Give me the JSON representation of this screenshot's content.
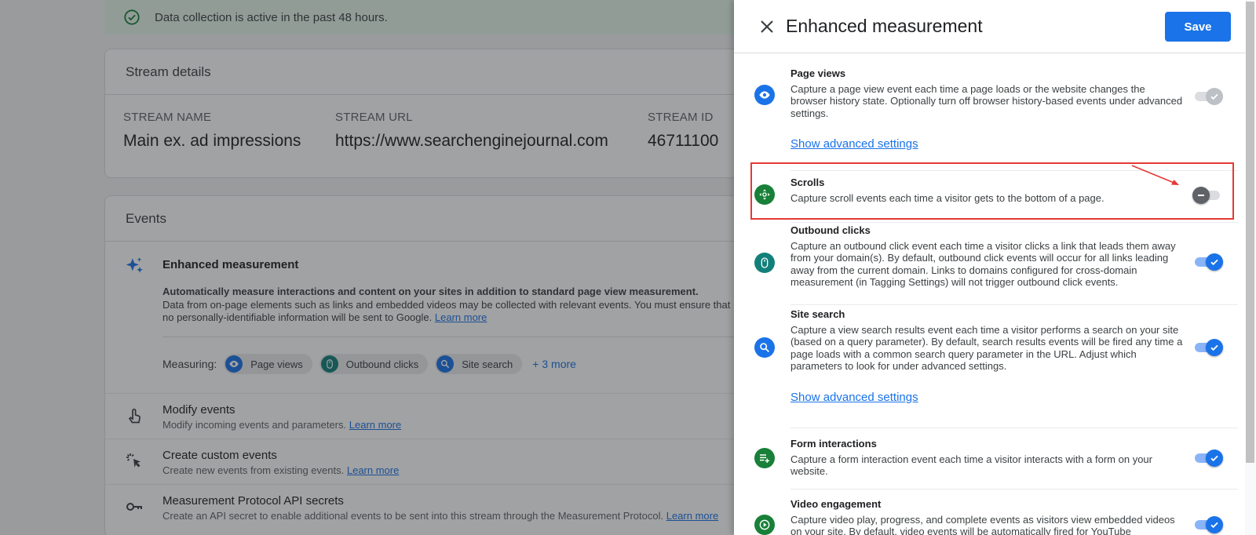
{
  "banner": {
    "text": "Data collection is active in the past 48 hours."
  },
  "stream_details": {
    "title": "Stream details",
    "name_label": "STREAM NAME",
    "name_value": "Main ex. ad impressions",
    "url_label": "STREAM URL",
    "url_value": "https://www.searchenginejournal.com",
    "id_label": "STREAM ID",
    "id_value": "46711100"
  },
  "events": {
    "title": "Events",
    "enhanced": {
      "title": "Enhanced measurement",
      "desc_bold": "Automatically measure interactions and content on your sites in addition to standard page view measurement.",
      "desc_rest": "Data from on-page elements such as links and embedded videos may be collected with relevant events. You must ensure that no personally-identifiable information will be sent to Google.",
      "learn_more": "Learn more",
      "measuring_label": "Measuring:",
      "chips": [
        "Page views",
        "Outbound clicks",
        "Site search"
      ],
      "more": "+ 3 more"
    },
    "rows": [
      {
        "title": "Modify events",
        "desc": "Modify incoming events and parameters.",
        "link": "Learn more"
      },
      {
        "title": "Create custom events",
        "desc": "Create new events from existing events.",
        "link": "Learn more"
      },
      {
        "title": "Measurement Protocol API secrets",
        "desc": "Create an API secret to enable additional events to be sent into this stream through the Measurement Protocol.",
        "link": "Learn more"
      }
    ]
  },
  "panel": {
    "title": "Enhanced measurement",
    "save_label": "Save",
    "sections": [
      {
        "title": "Page views",
        "desc": "Capture a page view event each time a page loads or the website changes the browser history state. Optionally turn off browser history-based events under advanced settings.",
        "advanced": "Show advanced settings",
        "state": "disabled-on"
      },
      {
        "title": "Scrolls",
        "desc": "Capture scroll events each time a visitor gets to the bottom of a page.",
        "state": "off"
      },
      {
        "title": "Outbound clicks",
        "desc": "Capture an outbound click event each time a visitor clicks a link that leads them away from your domain(s). By default, outbound click events will occur for all links leading away from the current domain. Links to domains configured for cross-domain measurement (in Tagging Settings) will not trigger outbound click events.",
        "state": "on"
      },
      {
        "title": "Site search",
        "desc": "Capture a view search results event each time a visitor performs a search on your site (based on a query parameter). By default, search results events will be fired any time a page loads with a common search query parameter in the URL. Adjust which parameters to look for under advanced settings.",
        "advanced": "Show advanced settings",
        "state": "on"
      },
      {
        "title": "Form interactions",
        "desc": "Capture a form interaction event each time a visitor interacts with a form on your website.",
        "state": "on"
      },
      {
        "title": "Video engagement",
        "desc": "Capture video play, progress, and complete events as visitors view embedded videos on your site. By default, video events will be automatically fired for YouTube",
        "state": "on"
      }
    ]
  },
  "colors": {
    "accent": "#1a73e8",
    "annotation": "#e53935",
    "icon_blue": "#1a73e8",
    "icon_green": "#188038",
    "icon_teal": "#12807a"
  }
}
